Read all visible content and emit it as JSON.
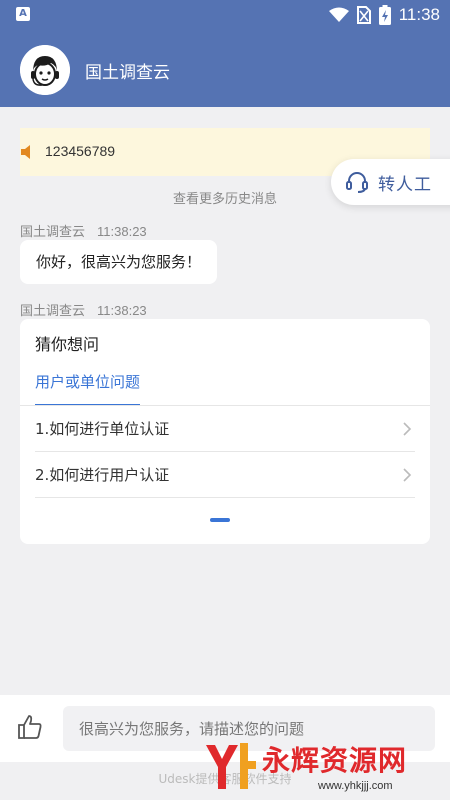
{
  "status_bar": {
    "time": "11:38",
    "app_icon_letter": "A",
    "icons": [
      "wifi-icon",
      "no-sim-icon",
      "battery-charging-icon"
    ]
  },
  "header": {
    "title": "国土调查云",
    "avatar": "agent-headset-avatar-icon"
  },
  "notice": {
    "text": "123456789",
    "icon": "speaker-icon"
  },
  "transfer": {
    "label": "转人工",
    "icon": "headset-icon"
  },
  "history_link": "查看更多历史消息",
  "messages": [
    {
      "sender": "国土调查云",
      "time": "11:38:23",
      "text": "你好，很高兴为您服务！"
    },
    {
      "sender": "国土调查云",
      "time": "11:38:23"
    }
  ],
  "faq": {
    "title": "猜你想问",
    "active_tab": "用户或单位问题",
    "items": [
      "1.如何进行单位认证",
      "2.如何进行用户认证"
    ]
  },
  "input": {
    "placeholder": "很高兴为您服务，请描述您的问题",
    "value": ""
  },
  "footer": {
    "powered_by": "Udesk提供客服软件支持"
  },
  "watermark": {
    "text": "永辉资源网",
    "url": "www.yhkjjj.com"
  },
  "colors": {
    "primary": "#5573b3",
    "accent": "#3a75d6",
    "notice_bg": "#fdf7dd",
    "watermark": "#e0292c"
  }
}
